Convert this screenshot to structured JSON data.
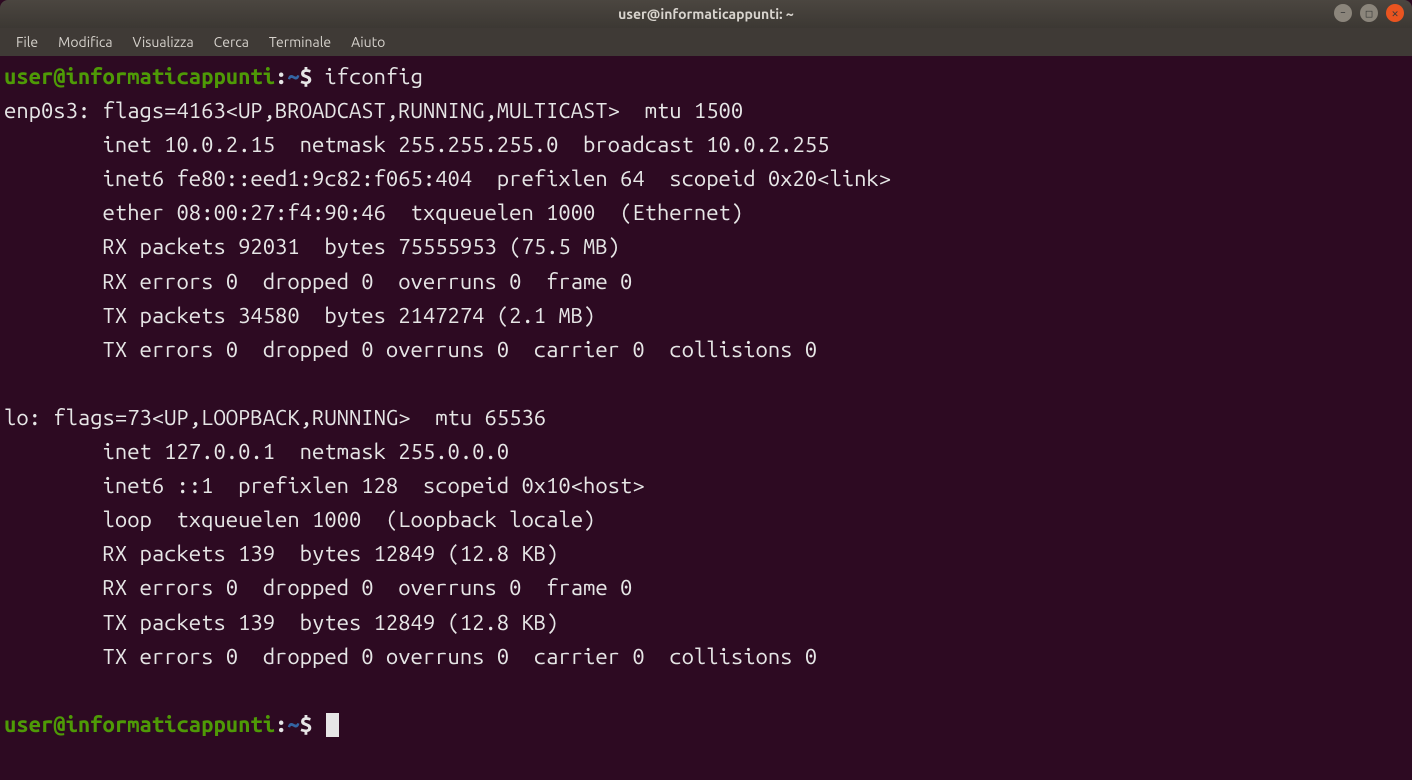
{
  "window": {
    "title": "user@informaticappunti: ~"
  },
  "menu": {
    "items": [
      "File",
      "Modifica",
      "Visualizza",
      "Cerca",
      "Terminale",
      "Aiuto"
    ]
  },
  "prompt": {
    "user_host": "user@informaticappunti",
    "sep": ":",
    "path": "~",
    "dollar": "$"
  },
  "command": "ifconfig",
  "output": {
    "lines": [
      "enp0s3: flags=4163<UP,BROADCAST,RUNNING,MULTICAST>  mtu 1500",
      "        inet 10.0.2.15  netmask 255.255.255.0  broadcast 10.0.2.255",
      "        inet6 fe80::eed1:9c82:f065:404  prefixlen 64  scopeid 0x20<link>",
      "        ether 08:00:27:f4:90:46  txqueuelen 1000  (Ethernet)",
      "        RX packets 92031  bytes 75555953 (75.5 MB)",
      "        RX errors 0  dropped 0  overruns 0  frame 0",
      "        TX packets 34580  bytes 2147274 (2.1 MB)",
      "        TX errors 0  dropped 0 overruns 0  carrier 0  collisions 0",
      "",
      "lo: flags=73<UP,LOOPBACK,RUNNING>  mtu 65536",
      "        inet 127.0.0.1  netmask 255.0.0.0",
      "        inet6 ::1  prefixlen 128  scopeid 0x10<host>",
      "        loop  txqueuelen 1000  (Loopback locale)",
      "        RX packets 139  bytes 12849 (12.8 KB)",
      "        RX errors 0  dropped 0  overruns 0  frame 0",
      "        TX packets 139  bytes 12849 (12.8 KB)",
      "        TX errors 0  dropped 0 overruns 0  carrier 0  collisions 0",
      ""
    ]
  },
  "win_controls": {
    "min": "–",
    "max": "□",
    "close": "✕"
  }
}
